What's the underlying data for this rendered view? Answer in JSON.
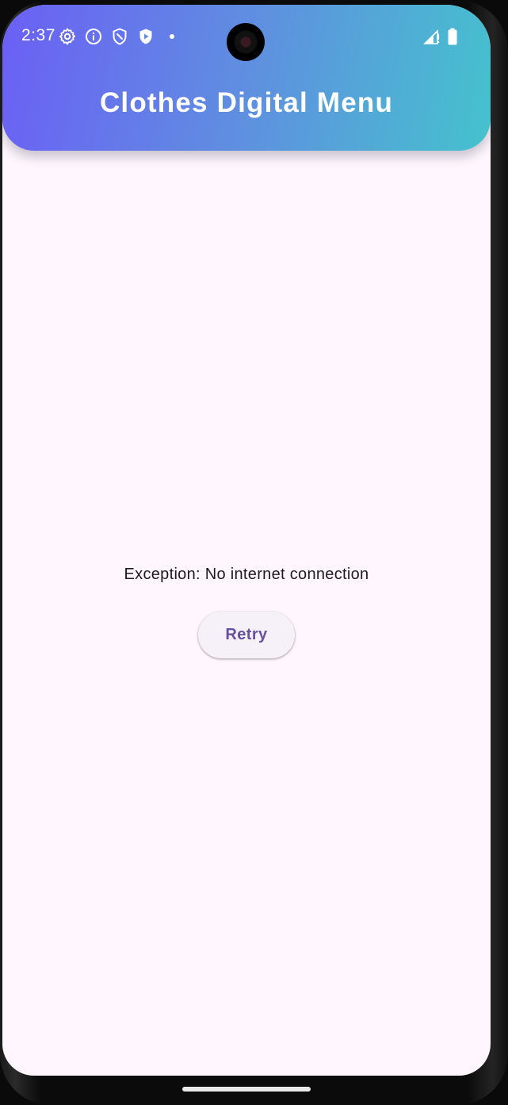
{
  "status_bar": {
    "time": "2:37",
    "left_icons": [
      "gear-icon",
      "info-icon",
      "shield-icon",
      "play-shield-icon",
      "dot-icon"
    ],
    "right_icons": [
      "signal-icon",
      "battery-icon"
    ]
  },
  "app_bar": {
    "title": "Clothes Digital Menu",
    "gradient": [
      "#6b5ff5",
      "#45c2cd"
    ]
  },
  "content": {
    "error_message": "Exception: No internet connection",
    "retry_label": "Retry"
  },
  "colors": {
    "background": "#fff7fd",
    "button_text": "#65509f",
    "button_background": "#f6f1f8"
  }
}
